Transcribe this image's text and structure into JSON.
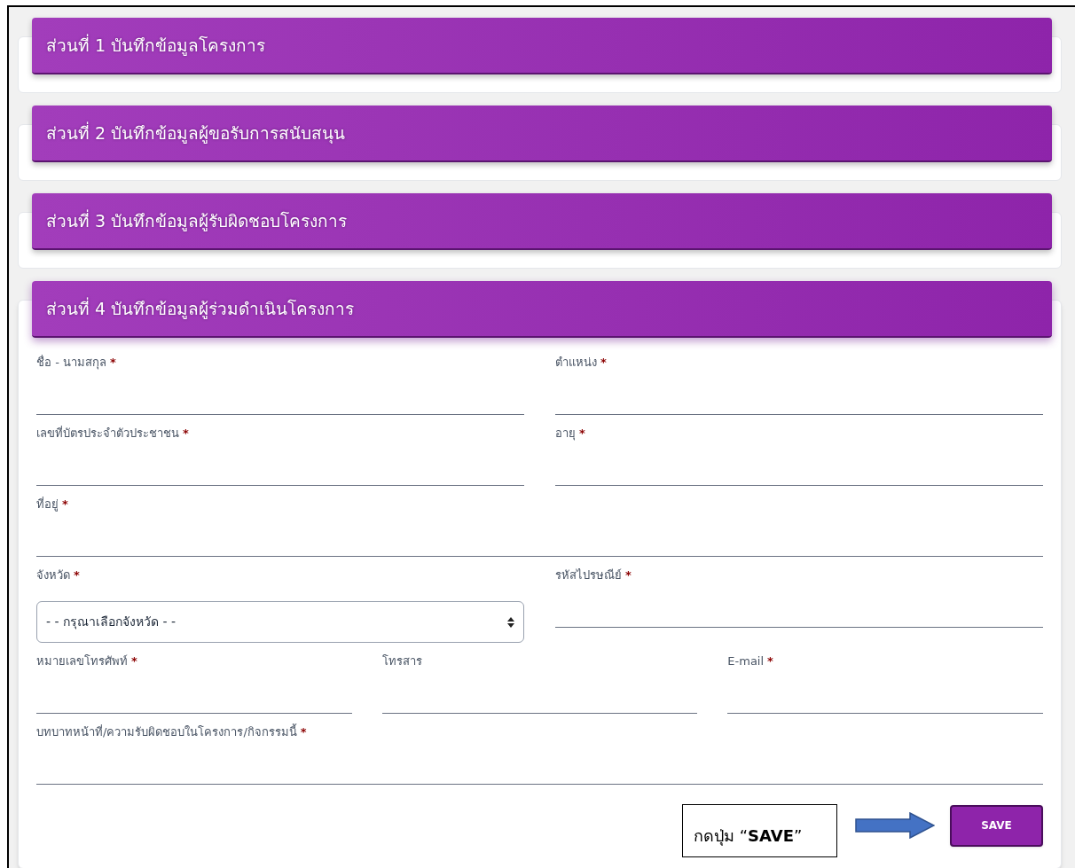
{
  "sections": [
    {
      "title": "ส่วนที่ 1 บันทึกข้อมูลโครงการ",
      "expanded": false
    },
    {
      "title": "ส่วนที่ 2 บันทึกข้อมูลผู้ขอรับการสนับสนุน",
      "expanded": false
    },
    {
      "title": "ส่วนที่ 3 บันทึกข้อมูลผู้รับผิดชอบโครงการ",
      "expanded": false
    },
    {
      "title": "ส่วนที่ 4 บันทึกข้อมูลผู้ร่วมดำเนินโครงการ",
      "expanded": true
    }
  ],
  "form": {
    "rows": [
      [
        {
          "kind": "text",
          "label": "ชื่อ - นามสกุล",
          "mark": "*"
        },
        {
          "kind": "text",
          "label": "ตำแหน่ง",
          "mark": "*"
        }
      ],
      [
        {
          "kind": "text",
          "label": "เลขที่บัตรประจำตัวประชาชน",
          "mark": "*"
        },
        {
          "kind": "text",
          "label": "อายุ",
          "mark": "*"
        }
      ],
      [
        {
          "kind": "text",
          "label": "ที่อยู่",
          "mark": "*"
        }
      ],
      [
        {
          "kind": "select",
          "label": "จังหวัด",
          "mark": "*",
          "value": "- - กรุณาเลือกจังหวัด - -"
        },
        {
          "kind": "text",
          "label": "รหัสไปรษณีย์",
          "mark": "*"
        }
      ],
      [
        {
          "kind": "text",
          "label": "หมายเลขโทรศัพท์",
          "mark": "*"
        },
        {
          "kind": "text",
          "label": "โทรสาร"
        },
        {
          "kind": "text",
          "label": "E-mail",
          "mark": "*"
        }
      ],
      [
        {
          "kind": "text",
          "label": "บทบาทหน้าที่/ความรับผิดชอบในโครงการ/กิจกรรมนี้",
          "mark": "*"
        }
      ]
    ],
    "callout": "กดปุ่ม “**SAVE**”",
    "save_button": "SAVE"
  }
}
